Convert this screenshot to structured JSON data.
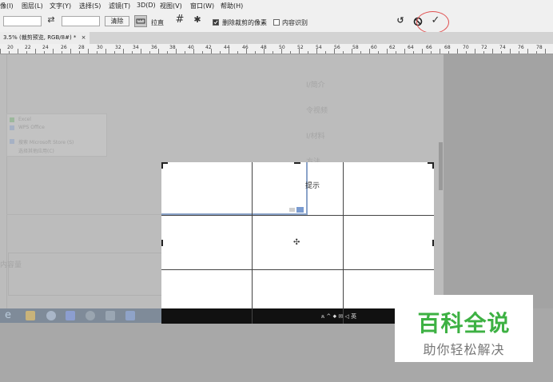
{
  "menu": {
    "items": [
      "像(I)",
      "图层(L)",
      "文字(Y)",
      "选择(S)",
      "滤镜(T)",
      "3D(D)",
      "视图(V)",
      "窗口(W)",
      "帮助(H)"
    ]
  },
  "options": {
    "swap_icon": "swap-arrows-icon",
    "clear_label": "清除",
    "straighten_label": "拉直",
    "overlay_icon": "grid-overlay-icon",
    "settings_icon": "gear-icon",
    "delete_cropped_label": "删除裁剪的像素",
    "delete_cropped_checked": true,
    "content_aware_label": "内容识别",
    "content_aware_checked": false,
    "reset_icon": "undo-icon",
    "cancel_icon": "cancel-icon",
    "commit_icon": "checkmark-icon",
    "commit_glyph": "✓",
    "cancel_glyph": "⃠",
    "reset_glyph": "↺",
    "swap_glyph": "⇄",
    "settings_glyph": "✱",
    "overlay_glyph": "#"
  },
  "document": {
    "tab_title": "3.5% (裁剪预览, RGB/8#) *",
    "close_glyph": "×"
  },
  "ruler": {
    "labels": [
      "20",
      "22",
      "24",
      "26",
      "28",
      "30",
      "32",
      "34",
      "36",
      "38",
      "40",
      "42",
      "44",
      "46",
      "48",
      "50",
      "52",
      "54",
      "56",
      "58",
      "60",
      "62",
      "64",
      "66",
      "68",
      "70",
      "72",
      "74",
      "76",
      "78"
    ]
  },
  "background": {
    "ghost_lines": [
      "I/简介",
      "令视频",
      "I/材料",
      "方法",
      "提示"
    ],
    "popup_items": [
      "Excel",
      "WPS Office",
      "搜索 Microsoft Store (S)",
      "选择其他应用(C)"
    ],
    "bottom_left_text": "内容量"
  },
  "crop": {
    "center_marker": "✣",
    "taskbar_icons": "ጰ ^ ⬥ ✉ ◁ 英"
  },
  "watermark": {
    "title": "百科全说",
    "subtitle": "助你轻松解决",
    "title_color": "#3db143"
  }
}
